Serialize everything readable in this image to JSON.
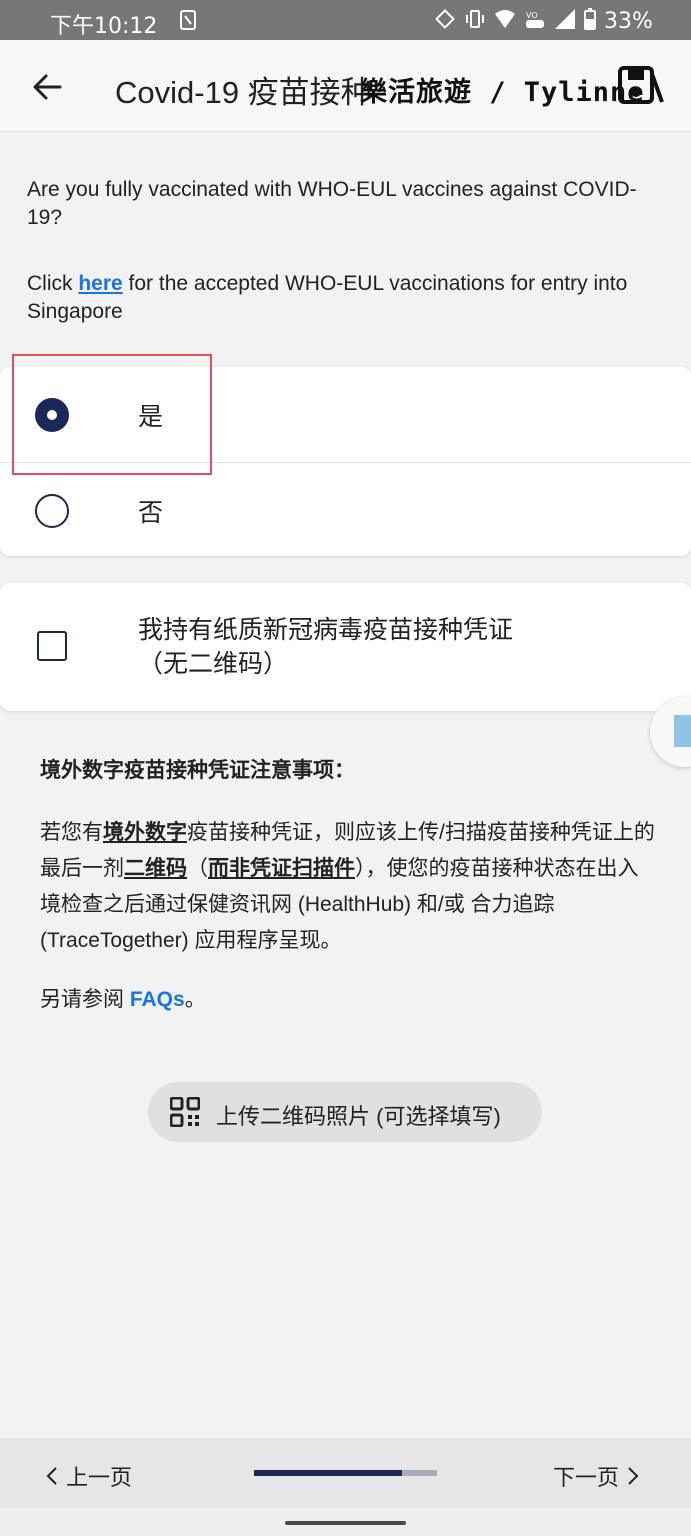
{
  "status_bar": {
    "time": "下午10:12",
    "battery_percent": "33%",
    "icons": [
      "notification-icon",
      "rotate-icon",
      "vibrate-icon",
      "wifi-icon",
      "volte-icon",
      "signal-icon",
      "battery-icon"
    ]
  },
  "app_bar": {
    "title": "Covid-19 疫苗接种",
    "watermark": "樂活旅遊 / Tylinne"
  },
  "question": {
    "text": "Are you fully vaccinated with WHO-EUL vaccines against COVID-19?",
    "link_prefix": "Click ",
    "link_text": "here",
    "link_suffix": " for the accepted WHO-EUL vaccinations for entry into Singapore"
  },
  "options": {
    "yes_label": "是",
    "no_label": "否",
    "selected": "yes"
  },
  "paper_certificate": {
    "line1": "我持有纸质新冠病毒疫苗接种凭证",
    "line2": "（无二维码）",
    "checked": false
  },
  "notice": {
    "title": "境外数字疫苗接种凭证注意事项：",
    "p1": "若您有",
    "p2": "境外数字",
    "p3": "疫苗接种凭证，则应该上传/扫描疫苗接种凭证上的最后一剂",
    "p4": "二维码",
    "p5": "（",
    "p6": "而非凭证扫描件",
    "p7": "），使您的疫苗接种状态在出入境检查之后通过保健资讯网 (HealthHub) 和/或 合力追踪 (TraceTogether) 应用程序呈现。",
    "faq_prefix": "另请参阅 ",
    "faq_link": "FAQs",
    "faq_suffix": "。"
  },
  "upload_button": {
    "label": "上传二维码照片 (可选择填写)"
  },
  "bottom_nav": {
    "prev_label": "上一页",
    "next_label": "下一页",
    "progress": 0.81
  },
  "colors": {
    "primary": "#1b2755",
    "link": "#1a73e8",
    "highlight": "#e0505a",
    "status_bar": "#777777"
  }
}
